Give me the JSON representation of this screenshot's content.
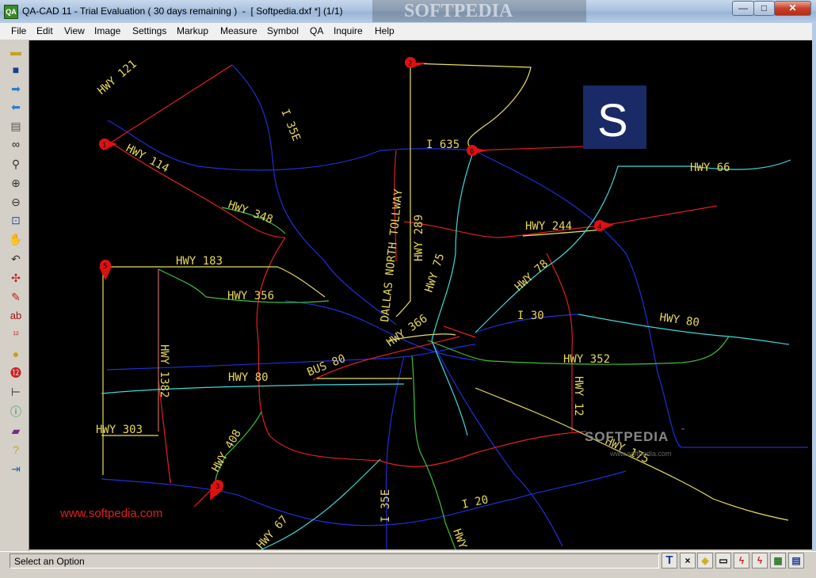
{
  "window": {
    "title": "QA-CAD 11 - Trial Evaluation ( 30 days remaining )  -  [ Softpedia.dxf *] (1/1)",
    "watermark": "SOFTPEDIA",
    "minimize": "—",
    "maximize": "□",
    "close": "✕"
  },
  "menu": [
    "File",
    "Edit",
    "View",
    "Image",
    "Settings",
    "Markup",
    "Measure",
    "Symbol",
    "QA",
    "Inquire",
    "Help"
  ],
  "toolbar": {
    "icons": [
      "open-folder-icon",
      "save-disk-icon",
      "forward-arrow-icon",
      "back-arrow-icon",
      "print-icon",
      "binoculars-icon",
      "zoom-icon",
      "zoom-in-icon",
      "zoom-out-icon",
      "zoom-window-icon",
      "pan-hand-icon",
      "undo-icon",
      "move-icon",
      "pencil-icon",
      "text-ab-icon",
      "numbering-icon",
      "bulb-icon",
      "balloon-icon",
      "dimension-icon",
      "info-icon",
      "book-icon",
      "help-icon",
      "exit-icon"
    ]
  },
  "map": {
    "highways": [
      "HWY 121",
      "I 35E",
      "HWY 114",
      "I 635",
      "HWY 66",
      "HWY 348",
      "DALLAS NORTH TOLLWAY",
      "HWY 289",
      "HWY 244",
      "HWY 183",
      "HWY 75",
      "HWY 78",
      "HWY 356",
      "I 30",
      "HWY 80",
      "HWY 366",
      "BUS 80",
      "HWY 352",
      "HWY 1382",
      "HWY 80",
      "HWY 12",
      "HWY 303",
      "HWY 408",
      "HWY 175",
      "I 35E",
      "I 20",
      "HWY 67",
      "HWY"
    ],
    "markers": [
      "1",
      "2",
      "3",
      "4",
      "5",
      "6"
    ],
    "logo_letter": "S",
    "softpedia_mark": "SOFTPEDIA",
    "softpedia_tm": "™",
    "softpedia_url_small": "www.softpedia.com",
    "softpedia_url": "www.softpedia.com"
  },
  "status": {
    "message": "Select an Option",
    "buttons": [
      "T",
      "×",
      "◆",
      "▭",
      "ϟ",
      "ϟ",
      "▦",
      "▤"
    ]
  }
}
